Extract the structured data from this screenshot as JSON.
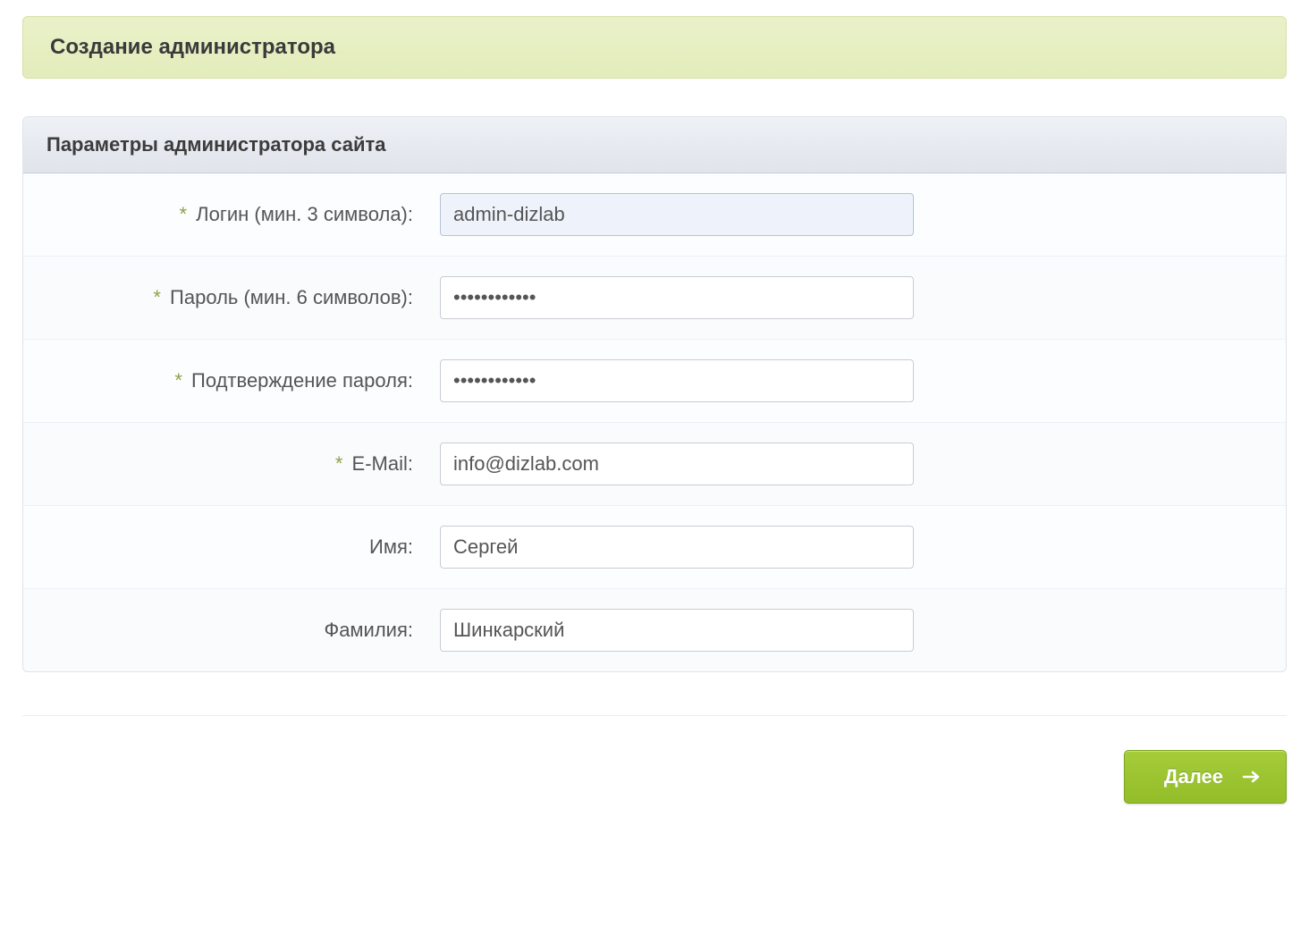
{
  "header": {
    "title": "Создание администратора"
  },
  "panel": {
    "title": "Параметры администратора сайта"
  },
  "fields": {
    "login": {
      "required": true,
      "label": "Логин (мин. 3 символа):",
      "value": "admin-dizlab",
      "type": "text"
    },
    "password": {
      "required": true,
      "label": "Пароль (мин. 6 символов):",
      "value": "••••••••••••",
      "type": "password"
    },
    "confirm": {
      "required": true,
      "label": "Подтверждение пароля:",
      "value": "••••••••••••",
      "type": "password"
    },
    "email": {
      "required": true,
      "label": "E-Mail:",
      "value": "info@dizlab.com",
      "type": "text"
    },
    "first": {
      "required": false,
      "label": "Имя:",
      "value": "Сергей",
      "type": "text"
    },
    "last": {
      "required": false,
      "label": "Фамилия:",
      "value": "Шинкарский",
      "type": "text"
    }
  },
  "footer": {
    "next_label": "Далее"
  },
  "required_marker": "*"
}
